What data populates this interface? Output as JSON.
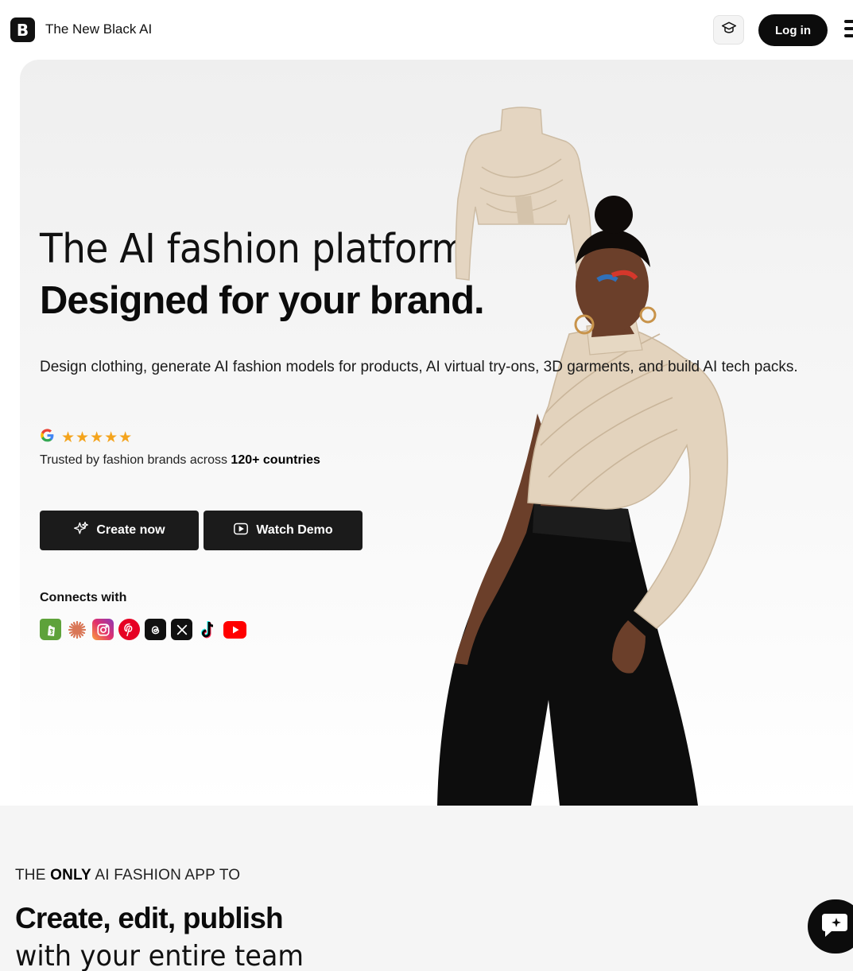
{
  "header": {
    "logo_letter": "B",
    "brand": "The New Black AI",
    "login_label": "Log in"
  },
  "hero": {
    "title_line1": "The AI fashion platform",
    "title_line2": "Designed for your brand.",
    "description": "Design clothing, generate AI fashion models for products, AI virtual try-ons, 3D garments, and build AI tech packs.",
    "rating_stars": "★★★★★",
    "trusted_prefix": "Trusted by fashion brands across ",
    "trusted_count": "120+ countries",
    "create_label": "Create now",
    "demo_label": "Watch Demo",
    "connects_label": "Connects with",
    "integrations": [
      "shopify-icon",
      "claude-icon",
      "instagram-icon",
      "pinterest-icon",
      "threads-icon",
      "x-icon",
      "tiktok-icon",
      "youtube-icon"
    ]
  },
  "section2": {
    "kicker_prefix": "THE ",
    "kicker_bold": "ONLY",
    "kicker_suffix": " AI FASHION APP TO",
    "title": "Create, edit, publish",
    "subtitle": "with your entire team"
  },
  "colors": {
    "accent_dark": "#0c0c0c",
    "star": "#f4a41d",
    "jacket": "#e2d2bc",
    "pants": "#0d0d0d"
  }
}
